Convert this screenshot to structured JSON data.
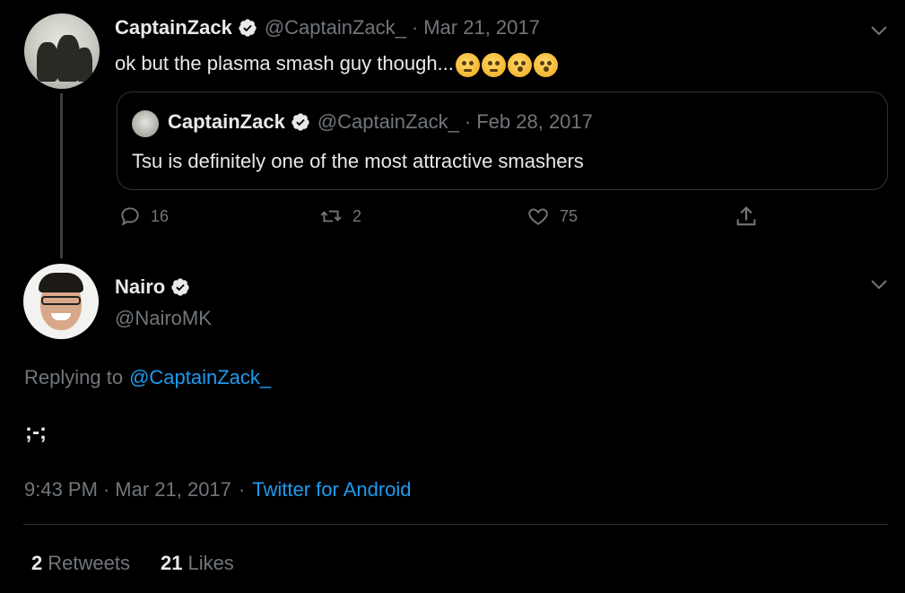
{
  "parent_tweet": {
    "author_name": "CaptainZack",
    "handle": "@CaptainZack_",
    "separator": "·",
    "date": "Mar 21, 2017",
    "text": "ok but the plasma smash guy though...",
    "emoji_icons": [
      "confounded-face-icon",
      "confounded-face-icon",
      "flushed-face-icon",
      "flushed-face-icon"
    ],
    "quoted_tweet": {
      "author_name": "CaptainZack",
      "handle": "@CaptainZack_",
      "separator": "·",
      "date": "Feb 28, 2017",
      "text": "Tsu is definitely one of the most attractive smashers"
    },
    "actions": {
      "reply_count": "16",
      "retweet_count": "2",
      "like_count": "75"
    }
  },
  "main_tweet": {
    "author_name": "Nairo",
    "handle": "@NairoMK",
    "replying_prefix": "Replying to",
    "replying_to": "@CaptainZack_",
    "text": ";-;",
    "time": "9:43 PM",
    "separator": "·",
    "date": "Mar 21, 2017",
    "source": "Twitter for Android",
    "retweets_count": "2",
    "retweets_label": "Retweets",
    "likes_count": "21",
    "likes_label": "Likes"
  },
  "colors": {
    "background": "#000000",
    "text": "#e7e9ea",
    "muted": "#71767b",
    "link": "#1d9bf0",
    "border": "#2f3336"
  }
}
